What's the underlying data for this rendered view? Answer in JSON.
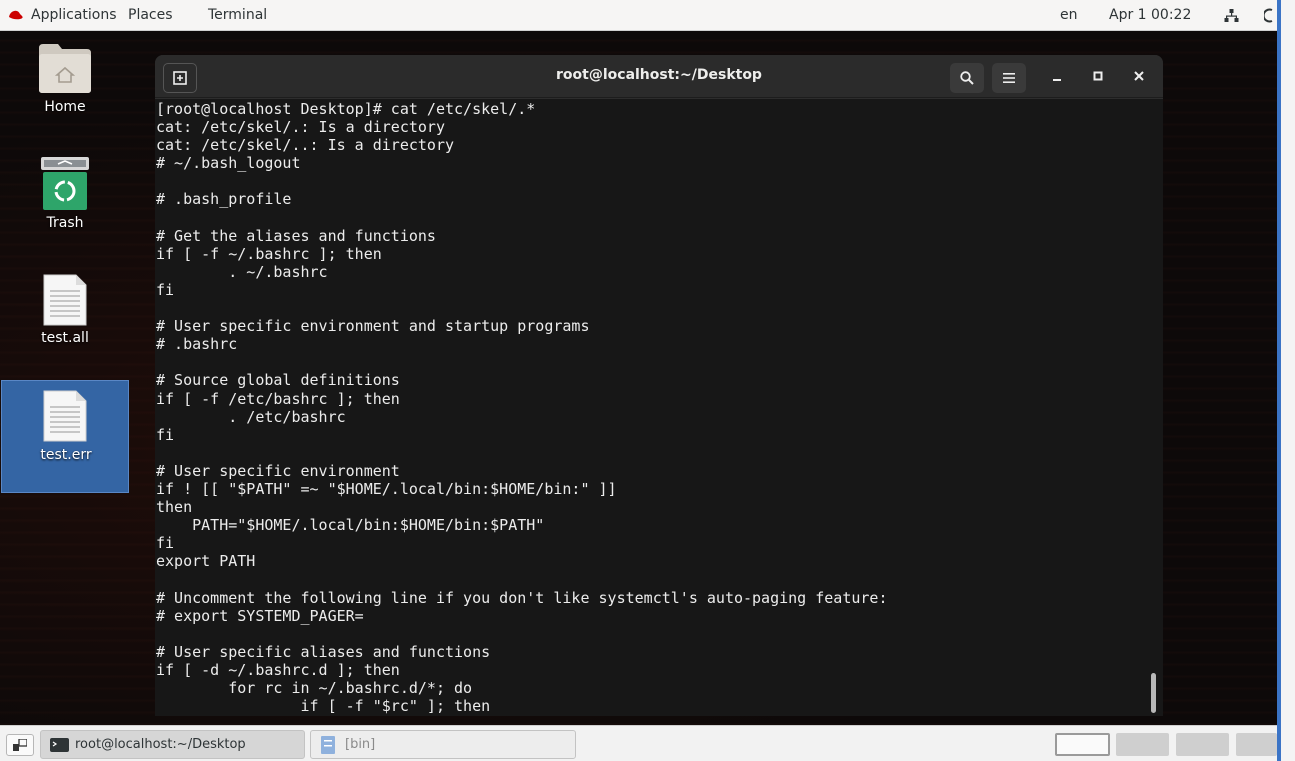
{
  "topbar": {
    "applications": "Applications",
    "places": "Places",
    "terminal": "Terminal",
    "lang": "en",
    "clock": "Apr 1  00:22"
  },
  "desktop_icons": [
    {
      "label": "Home",
      "icon": "home-folder-icon"
    },
    {
      "label": "Trash",
      "icon": "trash-icon"
    },
    {
      "label": "test.all",
      "icon": "text-file-icon"
    },
    {
      "label": "test.err",
      "icon": "text-file-icon"
    }
  ],
  "terminal": {
    "title": "root@localhost:~/Desktop",
    "lines": [
      "[root@localhost Desktop]# cat /etc/skel/.*",
      "cat: /etc/skel/.: Is a directory",
      "cat: /etc/skel/..: Is a directory",
      "# ~/.bash_logout",
      "",
      "# .bash_profile",
      "",
      "# Get the aliases and functions",
      "if [ -f ~/.bashrc ]; then",
      "        . ~/.bashrc",
      "fi",
      "",
      "# User specific environment and startup programs",
      "# .bashrc",
      "",
      "# Source global definitions",
      "if [ -f /etc/bashrc ]; then",
      "        . /etc/bashrc",
      "fi",
      "",
      "# User specific environment",
      "if ! [[ \"$PATH\" =~ \"$HOME/.local/bin:$HOME/bin:\" ]]",
      "then",
      "    PATH=\"$HOME/.local/bin:$HOME/bin:$PATH\"",
      "fi",
      "export PATH",
      "",
      "# Uncomment the following line if you don't like systemctl's auto-paging feature:",
      "# export SYSTEMD_PAGER=",
      "",
      "# User specific aliases and functions",
      "if [ -d ~/.bashrc.d ]; then",
      "        for rc in ~/.bashrc.d/*; do",
      "                if [ -f \"$rc\" ]; then"
    ]
  },
  "taskbar": {
    "items": [
      {
        "label": "root@localhost:~/Desktop",
        "active": true
      },
      {
        "label": "[bin]",
        "active": false
      }
    ]
  },
  "colors": {
    "accent": "#3465a4",
    "terminal_bg": "#171717",
    "terminal_fg": "#ececec"
  }
}
